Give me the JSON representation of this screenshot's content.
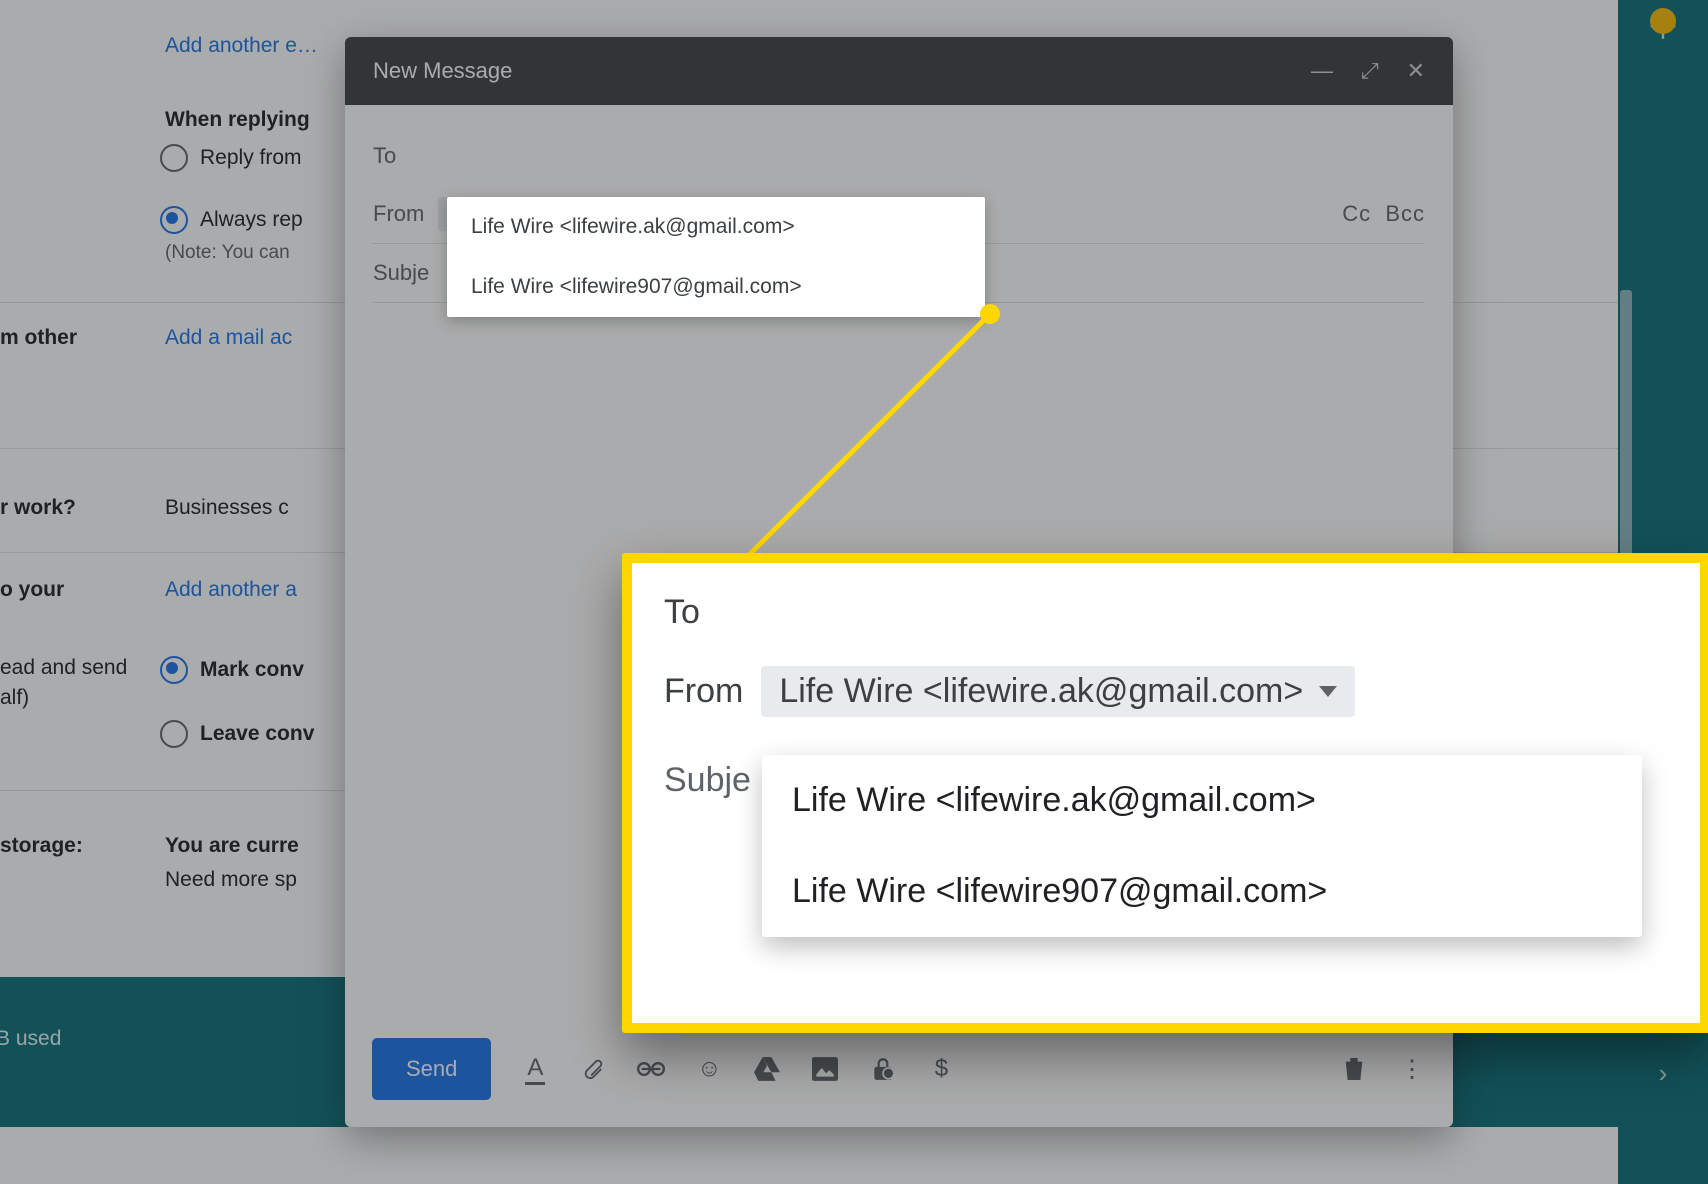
{
  "settings": {
    "add_email_link": "Add another e…",
    "when_replying_heading": "When replying",
    "reply_from_label": "Reply from",
    "always_reply_label": "Always rep",
    "always_reply_note": "(Note: You can",
    "m_other_label": "m other",
    "add_mail_account_link": "Add a mail ac",
    "r_work_label": "r work?",
    "businesses_text": "Businesses c",
    "o_your_label": "o your",
    "add_another_link": "Add another a",
    "ead_send_label": "ead and send",
    "alf_label": "alf)",
    "mark_conv_label": "Mark conv",
    "leave_conv_label": "Leave conv",
    "storage_label": "storage:",
    "you_are_curr": "You are curre",
    "need_more": "Need more sp",
    "used_text": "B used"
  },
  "compose": {
    "title": "New Message",
    "to_label": "To",
    "from_label": "From",
    "from_selected": "Life Wire <lifewire.ak@gmail.com>",
    "cc_label": "Cc",
    "bcc_label": "Bcc",
    "subject_label": "Subje",
    "dropdown_options": [
      "Life Wire <lifewire.ak@gmail.com>",
      "Life Wire <lifewire907@gmail.com>"
    ],
    "send_label": "Send"
  },
  "callout": {
    "to_label": "To",
    "from_label": "From",
    "from_selected": "Life Wire <lifewire.ak@gmail.com>",
    "subject_label": "Subje",
    "dropdown_options": [
      "Life Wire <lifewire.ak@gmail.com>",
      "Life Wire <lifewire907@gmail.com>"
    ]
  },
  "icons": {
    "plus": "＋",
    "chevron_right": "›",
    "minimize": "—",
    "expand": "⤢",
    "close": "✕",
    "text_format": "A",
    "emoji": "☺",
    "dollar": "$",
    "more": "⋮"
  }
}
